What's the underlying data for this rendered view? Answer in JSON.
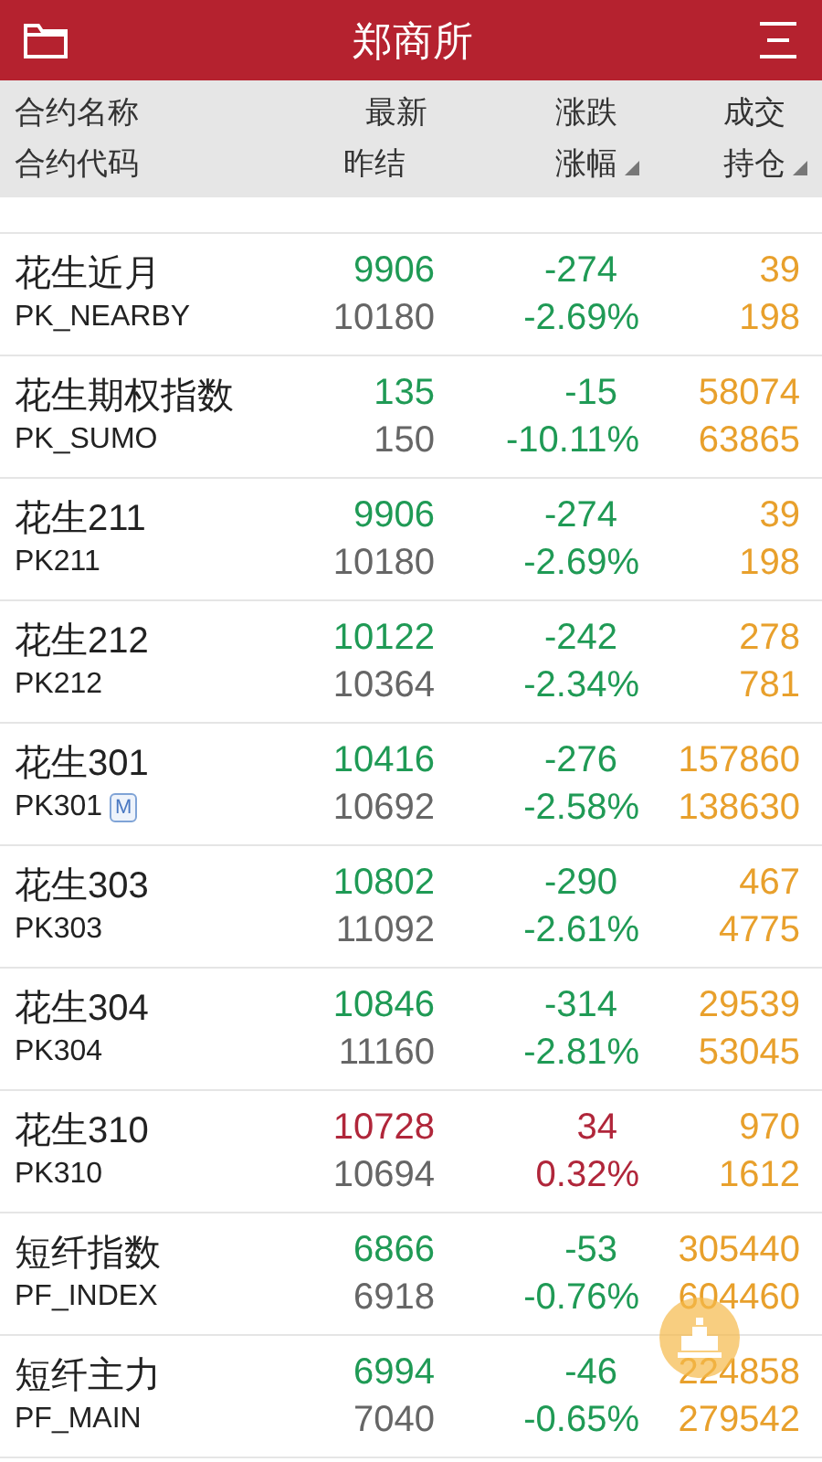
{
  "title": "郑商所",
  "columns": [
    {
      "line1": "合约名称",
      "line2": "合约代码",
      "sortable": false
    },
    {
      "line1": "最新",
      "line2": "昨结",
      "sortable": false
    },
    {
      "line1": "涨跌",
      "line2": "涨幅",
      "sortable": true
    },
    {
      "line1": "成交",
      "line2": "持仓",
      "sortable": true
    }
  ],
  "rows": [
    {
      "name": "花生近月",
      "code": "PK_NEARBY",
      "last": "9906",
      "prev": "10180",
      "change": "-274",
      "pct": "-2.69%",
      "volume": "39",
      "oi": "198",
      "kind": "down"
    },
    {
      "name": "花生期权指数",
      "code": "PK_SUMO",
      "last": "135",
      "prev": "150",
      "change": "-15",
      "pct": "-10.11%",
      "volume": "58074",
      "oi": "63865",
      "kind": "down"
    },
    {
      "name": "花生211",
      "code": "PK211",
      "last": "9906",
      "prev": "10180",
      "change": "-274",
      "pct": "-2.69%",
      "volume": "39",
      "oi": "198",
      "kind": "down"
    },
    {
      "name": "花生212",
      "code": "PK212",
      "last": "10122",
      "prev": "10364",
      "change": "-242",
      "pct": "-2.34%",
      "volume": "278",
      "oi": "781",
      "kind": "down"
    },
    {
      "name": "花生301",
      "code": "PK301",
      "badge": "M",
      "last": "10416",
      "prev": "10692",
      "change": "-276",
      "pct": "-2.58%",
      "volume": "157860",
      "oi": "138630",
      "kind": "down"
    },
    {
      "name": "花生303",
      "code": "PK303",
      "last": "10802",
      "prev": "11092",
      "change": "-290",
      "pct": "-2.61%",
      "volume": "467",
      "oi": "4775",
      "kind": "down"
    },
    {
      "name": "花生304",
      "code": "PK304",
      "last": "10846",
      "prev": "11160",
      "change": "-314",
      "pct": "-2.81%",
      "volume": "29539",
      "oi": "53045",
      "kind": "down"
    },
    {
      "name": "花生310",
      "code": "PK310",
      "last": "10728",
      "prev": "10694",
      "change": "34",
      "pct": "0.32%",
      "volume": "970",
      "oi": "1612",
      "kind": "up"
    },
    {
      "name": "短纤指数",
      "code": "PF_INDEX",
      "last": "6866",
      "prev": "6918",
      "change": "-53",
      "pct": "-0.76%",
      "volume": "305440",
      "oi": "604460",
      "kind": "down"
    },
    {
      "name": "短纤主力",
      "code": "PF_MAIN",
      "last": "6994",
      "prev": "7040",
      "change": "-46",
      "pct": "-0.65%",
      "volume": "224858",
      "oi": "279542",
      "kind": "down"
    }
  ]
}
